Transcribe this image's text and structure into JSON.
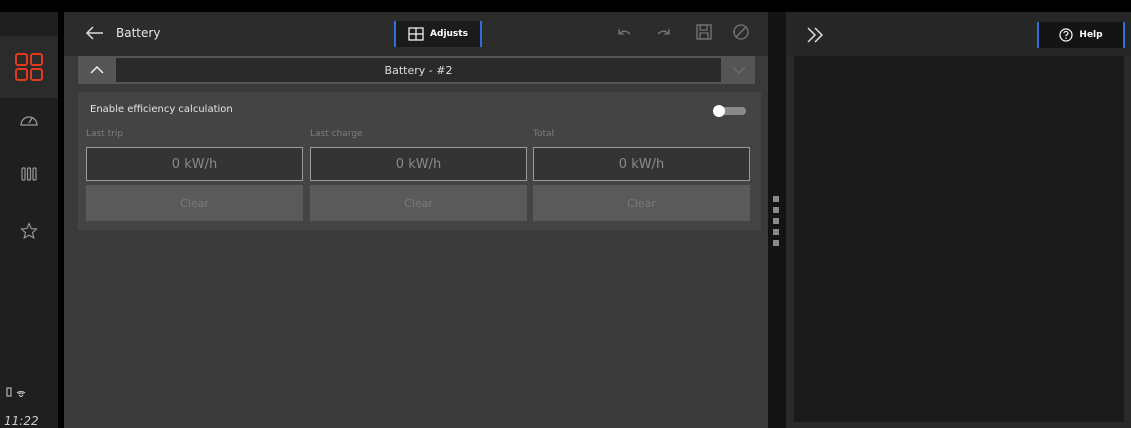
{
  "rail": {
    "items": [
      {
        "name": "apps",
        "icon": "apps-grid-icon"
      },
      {
        "name": "dashboard",
        "icon": "gauge-icon"
      },
      {
        "name": "columns",
        "icon": "columns-icon"
      },
      {
        "name": "favorites",
        "icon": "star-icon"
      }
    ],
    "time": "11:22",
    "accent": "#e23a1c"
  },
  "header": {
    "title": "Battery",
    "adjusts_label": "Adjusts"
  },
  "selector": {
    "value": "Battery - #2"
  },
  "card": {
    "toggle_label": "Enable efficiency calculation",
    "toggle_on": false,
    "columns": [
      {
        "label": "Last trip",
        "value": "0 kW/h",
        "button": "Clear"
      },
      {
        "label": "Last charge",
        "value": "0 kW/h",
        "button": "Clear"
      },
      {
        "label": "Total",
        "value": "0 kW/h",
        "button": "Clear"
      }
    ]
  },
  "right": {
    "help_label": "Help"
  },
  "colors": {
    "accent_blue": "#2f6fd8",
    "brand_red": "#e23a1c"
  }
}
